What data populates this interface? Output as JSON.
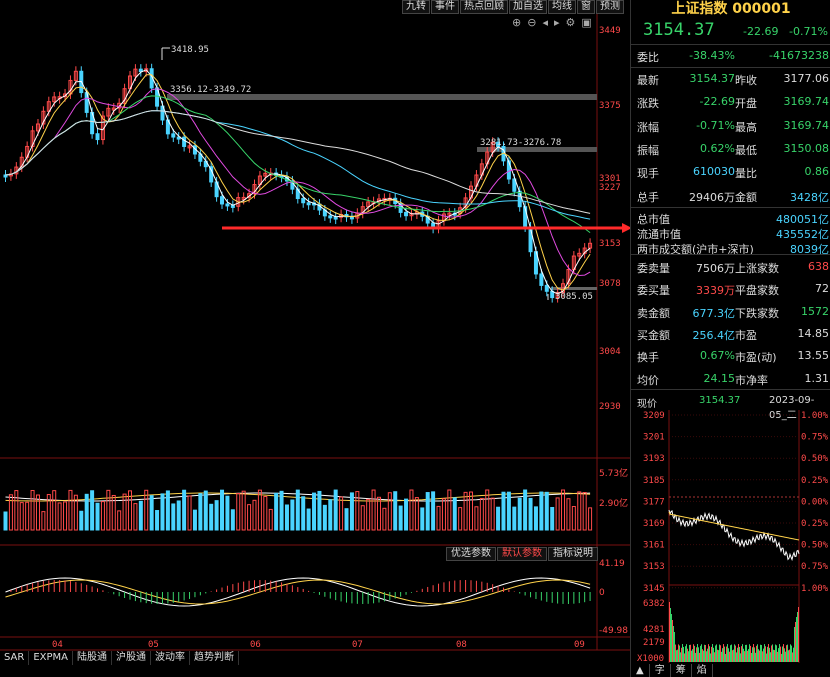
{
  "toolbar": [
    "九转",
    "事件",
    "热点回顾",
    "加自选",
    "均线",
    "窗",
    "预测"
  ],
  "price_axis": [
    "3449",
    "3375",
    "3301",
    "3227",
    "3153",
    "3078",
    "3004",
    "2930"
  ],
  "volume_axis": [
    "5.73亿",
    "2.90亿"
  ],
  "indicator_axis": [
    "41.19",
    "0",
    "-49.98"
  ],
  "month_labels": [
    "04",
    "05",
    "06",
    "07",
    "08",
    "09"
  ],
  "annotations": {
    "high": "3418.95",
    "zone1": "3356.12-3349.72",
    "zone2": "3281.73-3276.78",
    "low": "3085.05"
  },
  "sub_tabs": [
    "优选参数",
    "默认参数",
    "指标说明"
  ],
  "bottom_tabs": [
    "SAR",
    "EXPMA",
    "陆股通",
    "沪股通",
    "波动率",
    "趋势判断"
  ],
  "panel": {
    "title": "上证指数 000001",
    "price": "3154.37",
    "change": "-22.69",
    "change_pct": "-0.71%",
    "rows1": [
      {
        "l1": "委比",
        "v1": "-38.43%",
        "c1": "g",
        "l2": "",
        "v2": "-41673238",
        "c2": "g"
      }
    ],
    "rows2": [
      {
        "l1": "最新",
        "v1": "3154.37",
        "c1": "g",
        "l2": "昨收",
        "v2": "3177.06",
        "c2": "w"
      },
      {
        "l1": "涨跌",
        "v1": "-22.69",
        "c1": "g",
        "l2": "开盘",
        "v2": "3169.74",
        "c2": "g"
      },
      {
        "l1": "涨幅",
        "v1": "-0.71%",
        "c1": "g",
        "l2": "最高",
        "v2": "3169.74",
        "c2": "g"
      },
      {
        "l1": "振幅",
        "v1": "0.62%",
        "c1": "g",
        "l2": "最低",
        "v2": "3150.08",
        "c2": "g"
      },
      {
        "l1": "现手",
        "v1": "610030",
        "c1": "c",
        "l2": "量比",
        "v2": "0.86",
        "c2": "g"
      },
      {
        "l1": "总手",
        "v1": "29406万",
        "c1": "w",
        "l2": "金额",
        "v2": "3428亿",
        "c2": "c"
      }
    ],
    "wide_rows": [
      {
        "label": "总市值",
        "value": "480051亿"
      },
      {
        "label": "流通市值",
        "value": "435552亿"
      },
      {
        "label": "两市成交额(沪市+深市)",
        "value": "8039亿"
      }
    ],
    "rows3": [
      {
        "l1": "委卖量",
        "v1": "7506万",
        "c1": "w",
        "l2": "上涨家数",
        "v2": "638",
        "c2": "r"
      },
      {
        "l1": "委买量",
        "v1": "3339万",
        "c1": "r",
        "l2": "平盘家数",
        "v2": "72",
        "c2": "w"
      },
      {
        "l1": "卖金额",
        "v1": "677.3亿",
        "c1": "c",
        "l2": "下跌家数",
        "v2": "1572",
        "c2": "g"
      },
      {
        "l1": "买金额",
        "v1": "256.4亿",
        "c1": "c",
        "l2": "市盈",
        "v2": "14.85",
        "c2": "w"
      },
      {
        "l1": "换手",
        "v1": "0.67%",
        "c1": "g",
        "l2": "市盈(动)",
        "v2": "13.55",
        "c2": "w"
      },
      {
        "l1": "均价",
        "v1": "24.15",
        "c1": "g",
        "l2": "市净率",
        "v2": "1.31",
        "c2": "w"
      }
    ],
    "intraday_header": {
      "label": "现价",
      "price": "3154.37",
      "date": "2023-09-05_二"
    },
    "intraday_left": [
      "3209",
      "3201",
      "3193",
      "3185",
      "3177",
      "3169",
      "3161",
      "3153",
      "3145"
    ],
    "intraday_right": [
      "1.00%",
      "0.75%",
      "0.50%",
      "0.25%",
      "0.00%",
      "0.25%",
      "0.50%",
      "0.75%",
      "1.00%"
    ],
    "intraday_volume_axis": [
      "6382",
      "4281",
      "2179",
      "X1000"
    ],
    "tabs": [
      "字",
      "筹",
      "焰"
    ]
  }
}
